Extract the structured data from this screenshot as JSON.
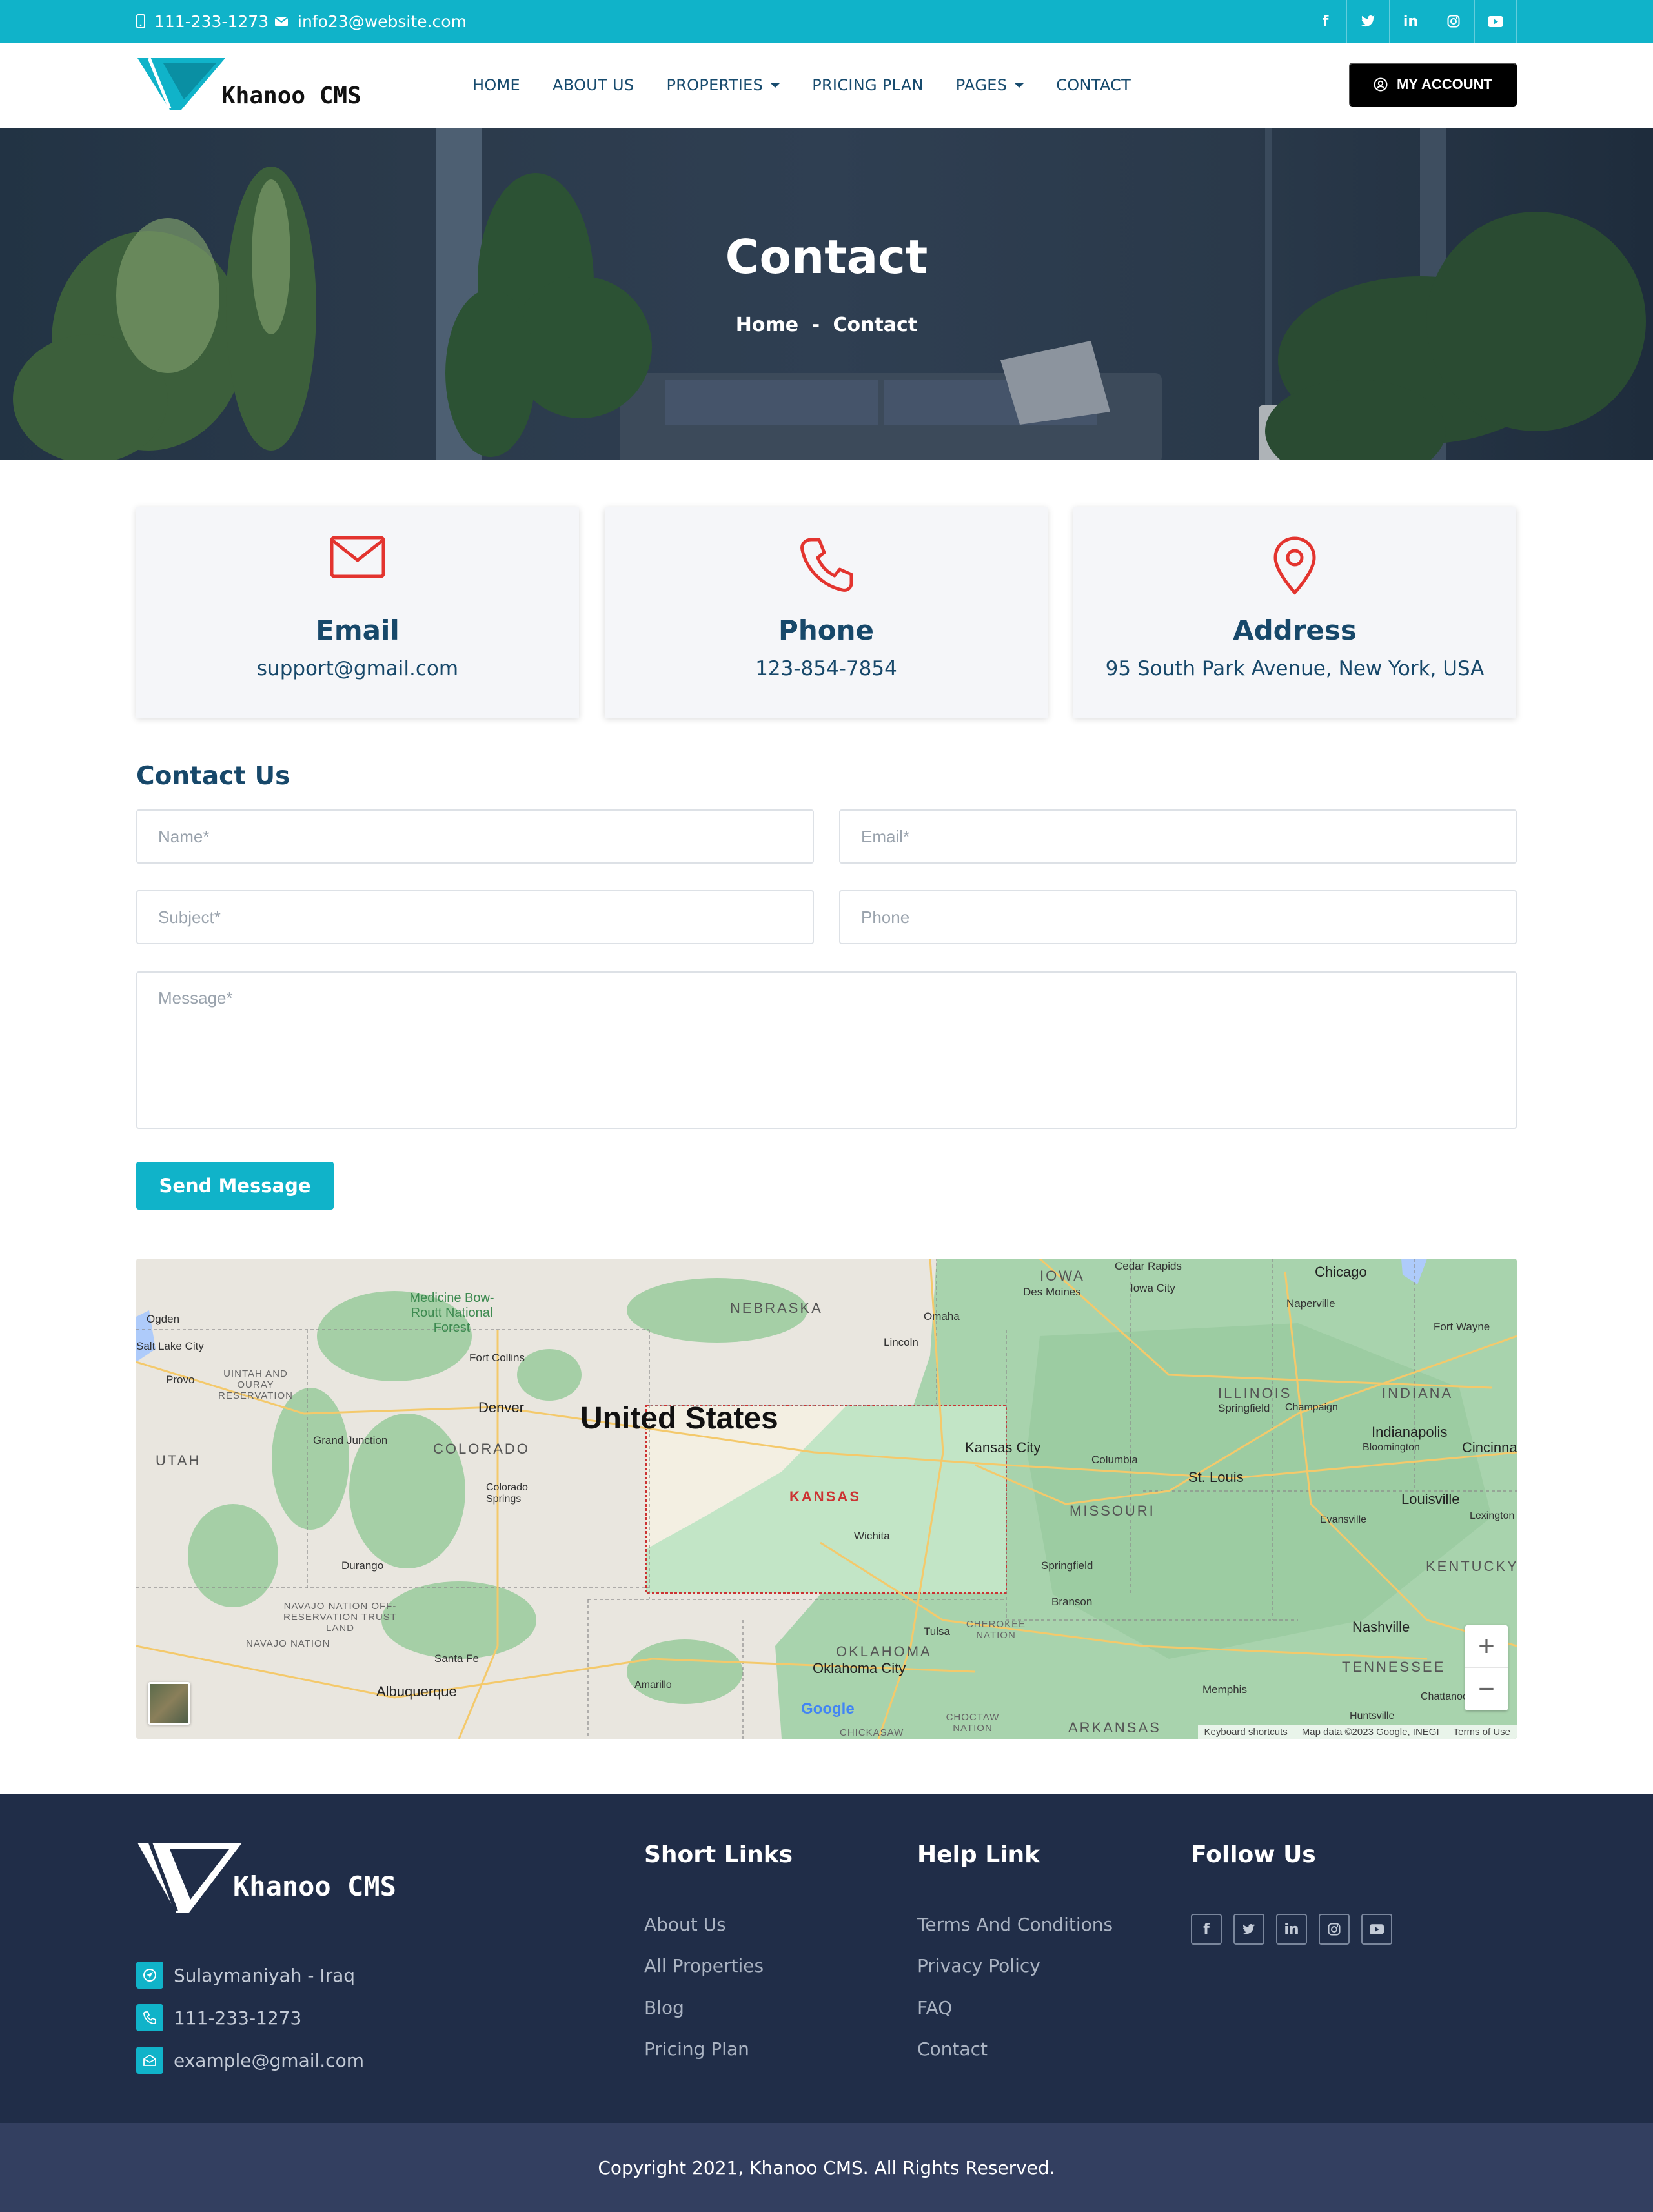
{
  "topbar": {
    "phone": "111-233-1273",
    "email": "info23@website.com",
    "socials": [
      {
        "icon": "facebook-icon",
        "glyph": "f"
      },
      {
        "icon": "twitter-icon",
        "glyph": "t"
      },
      {
        "icon": "linkedin-icon",
        "glyph": "in"
      },
      {
        "icon": "instagram-icon",
        "glyph": "◎"
      },
      {
        "icon": "youtube-icon",
        "glyph": "▶"
      }
    ]
  },
  "brand": {
    "name": "Khanoo  CMS"
  },
  "nav": {
    "items": [
      {
        "label": "HOME",
        "dropdown": false
      },
      {
        "label": "ABOUT US",
        "dropdown": false
      },
      {
        "label": "PROPERTIES",
        "dropdown": true
      },
      {
        "label": "PRICING PLAN",
        "dropdown": false
      },
      {
        "label": "PAGES",
        "dropdown": true
      },
      {
        "label": "CONTACT",
        "dropdown": false
      }
    ],
    "account_label": "MY ACCOUNT"
  },
  "hero": {
    "title": "Contact",
    "breadcrumb": {
      "home": "Home",
      "separator": "-",
      "current": "Contact"
    }
  },
  "cards": [
    {
      "icon": "envelope-icon",
      "title": "Email",
      "value": "support@gmail.com"
    },
    {
      "icon": "phone-icon",
      "title": "Phone",
      "value": "123-854-7854"
    },
    {
      "icon": "map-pin-icon",
      "title": "Address",
      "value": "95 South Park Avenue, New York, USA"
    }
  ],
  "form": {
    "heading": "Contact Us",
    "name_placeholder": "Name*",
    "email_placeholder": "Email*",
    "subject_placeholder": "Subject*",
    "phone_placeholder": "Phone",
    "message_placeholder": "Message*",
    "submit_label": "Send Message"
  },
  "map": {
    "country": "United States",
    "highlighted_state": "KANSAS",
    "states": [
      "IOWA",
      "NEBRASKA",
      "ILLINOIS",
      "INDIANA",
      "UTAH",
      "COLORADO",
      "MISSOURI",
      "KENTUCKY",
      "OKLAHOMA",
      "TENNESSEE",
      "ARKANSAS"
    ],
    "cities": [
      "Cedar Rapids",
      "Chicago",
      "Des Moines",
      "Iowa City",
      "Naperville",
      "Ogden",
      "Omaha",
      "Fort Wayne",
      "Salt Lake City",
      "Lincoln",
      "Provo",
      "Fort Collins",
      "Springfield",
      "Champaign",
      "Denver",
      "Indianapolis",
      "Bloomington",
      "Cincinnati",
      "Kansas City",
      "Grand Junction",
      "Columbia",
      "St. Louis",
      "Colorado Springs",
      "Louisville",
      "Evansville",
      "Lexington",
      "Wichita",
      "Durango",
      "Springfield",
      "Branson",
      "Tulsa",
      "Nashville",
      "Santa Fe",
      "Oklahoma City",
      "Amarillo",
      "Memphis",
      "Albuquerque",
      "Huntsville",
      "Chattanooga"
    ],
    "regions": [
      "Medicine Bow-Routt National Forest",
      "UINTAH AND OURAY RESERVATION",
      "NAVAJO NATION OFF-RESERVATION TRUST LAND",
      "NAVAJO NATION",
      "CHEROKEE NATION",
      "CHOCTAW NATION",
      "CHICKASAW"
    ],
    "zoom_in": "+",
    "zoom_out": "−",
    "google_logo": "Google",
    "attribution": [
      "Keyboard shortcuts",
      "Map data ©2023 Google, INEGI",
      "Terms of Use"
    ]
  },
  "footer": {
    "brand": "Khanoo  CMS",
    "contacts": [
      {
        "icon": "location-icon",
        "text": "Sulaymaniyah - Iraq"
      },
      {
        "icon": "phone-icon",
        "text": "111-233-1273"
      },
      {
        "icon": "envelope-icon",
        "text": "example@gmail.com"
      }
    ],
    "short_links": {
      "title": "Short Links",
      "items": [
        "About Us",
        "All Properties",
        "Blog",
        "Pricing Plan"
      ]
    },
    "help_links": {
      "title": "Help Link",
      "items": [
        "Terms And Conditions",
        "Privacy Policy",
        "FAQ",
        "Contact"
      ]
    },
    "follow": {
      "title": "Follow Us"
    },
    "copyright": "Copyright 2021, Khanoo CMS. All Rights Reserved."
  },
  "colors": {
    "accent": "#10b3c9",
    "primary_text": "#17486a",
    "icon_red": "#e3342f",
    "footer_bg": "#202d48",
    "footer_bottom": "#333f60"
  }
}
